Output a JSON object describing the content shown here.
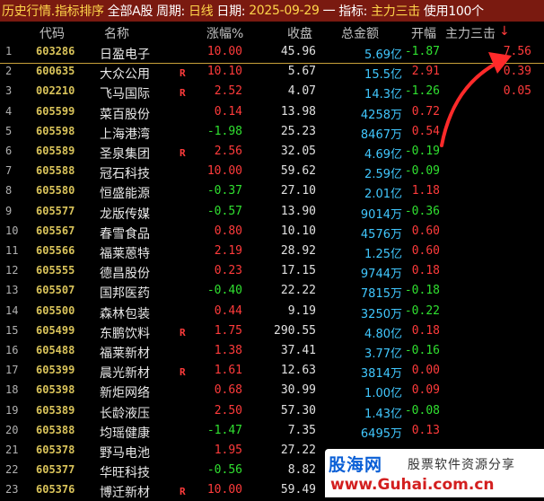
{
  "titlebar": {
    "history": "历史行情.指标排序",
    "market": "全部A股",
    "period_label": "周期:",
    "period_value": "日线",
    "date_label": "日期:",
    "date_value": "2025-09-29",
    "dash": "一",
    "indicator_label": "指标:",
    "indicator_value": "主力三击",
    "use_text": "使用100个"
  },
  "header": {
    "code": "代码",
    "name": "名称",
    "change": "涨幅%",
    "close": "收盘",
    "amount": "总金额",
    "open": "开幅",
    "zl": "主力三击",
    "sort_arrow": "↓"
  },
  "rows": [
    {
      "idx": "1",
      "code": "603286",
      "name": "日盈电子",
      "flag": "",
      "change": "10.00",
      "close": "45.96",
      "amount": "5.69亿",
      "open": "-1.87",
      "zl": "7.56"
    },
    {
      "idx": "2",
      "code": "600635",
      "name": "大众公用",
      "flag": "R",
      "change": "10.10",
      "close": "5.67",
      "amount": "15.5亿",
      "open": "2.91",
      "zl": "0.39"
    },
    {
      "idx": "3",
      "code": "002210",
      "name": "飞马国际",
      "flag": "R",
      "change": "2.52",
      "close": "4.07",
      "amount": "14.3亿",
      "open": "-1.26",
      "zl": "0.05"
    },
    {
      "idx": "4",
      "code": "605599",
      "name": "菜百股份",
      "flag": "",
      "change": "0.14",
      "close": "13.98",
      "amount": "4258万",
      "open": "0.72",
      "zl": ""
    },
    {
      "idx": "5",
      "code": "605598",
      "name": "上海港湾",
      "flag": "",
      "change": "-1.98",
      "close": "25.23",
      "amount": "8467万",
      "open": "0.54",
      "zl": ""
    },
    {
      "idx": "6",
      "code": "605589",
      "name": "圣泉集团",
      "flag": "R",
      "change": "2.56",
      "close": "32.05",
      "amount": "4.69亿",
      "open": "-0.19",
      "zl": ""
    },
    {
      "idx": "7",
      "code": "605588",
      "name": "冠石科技",
      "flag": "",
      "change": "10.00",
      "close": "59.62",
      "amount": "2.59亿",
      "open": "-0.09",
      "zl": ""
    },
    {
      "idx": "8",
      "code": "605580",
      "name": "恒盛能源",
      "flag": "",
      "change": "-0.37",
      "close": "27.10",
      "amount": "2.01亿",
      "open": "1.18",
      "zl": ""
    },
    {
      "idx": "9",
      "code": "605577",
      "name": "龙版传媒",
      "flag": "",
      "change": "-0.57",
      "close": "13.90",
      "amount": "9014万",
      "open": "-0.36",
      "zl": ""
    },
    {
      "idx": "10",
      "code": "605567",
      "name": "春雪食品",
      "flag": "",
      "change": "0.80",
      "close": "10.10",
      "amount": "4576万",
      "open": "0.60",
      "zl": ""
    },
    {
      "idx": "11",
      "code": "605566",
      "name": "福莱蒽特",
      "flag": "",
      "change": "2.19",
      "close": "28.92",
      "amount": "1.25亿",
      "open": "0.60",
      "zl": ""
    },
    {
      "idx": "12",
      "code": "605555",
      "name": "德昌股份",
      "flag": "",
      "change": "0.23",
      "close": "17.15",
      "amount": "9744万",
      "open": "0.18",
      "zl": ""
    },
    {
      "idx": "13",
      "code": "605507",
      "name": "国邦医药",
      "flag": "",
      "change": "-0.40",
      "close": "22.22",
      "amount": "7815万",
      "open": "-0.18",
      "zl": ""
    },
    {
      "idx": "14",
      "code": "605500",
      "name": "森林包装",
      "flag": "",
      "change": "0.44",
      "close": "9.19",
      "amount": "3250万",
      "open": "-0.22",
      "zl": ""
    },
    {
      "idx": "15",
      "code": "605499",
      "name": "东鹏饮料",
      "flag": "R",
      "change": "1.75",
      "close": "290.55",
      "amount": "4.80亿",
      "open": "0.18",
      "zl": ""
    },
    {
      "idx": "16",
      "code": "605488",
      "name": "福莱新材",
      "flag": "",
      "change": "1.38",
      "close": "37.41",
      "amount": "3.77亿",
      "open": "-0.16",
      "zl": ""
    },
    {
      "idx": "17",
      "code": "605399",
      "name": "晨光新材",
      "flag": "R",
      "change": "1.61",
      "close": "12.63",
      "amount": "3814万",
      "open": "0.00",
      "zl": ""
    },
    {
      "idx": "18",
      "code": "605398",
      "name": "新炬网络",
      "flag": "",
      "change": "0.68",
      "close": "30.99",
      "amount": "1.00亿",
      "open": "0.09",
      "zl": ""
    },
    {
      "idx": "19",
      "code": "605389",
      "name": "长龄液压",
      "flag": "",
      "change": "2.50",
      "close": "57.30",
      "amount": "1.43亿",
      "open": "-0.08",
      "zl": ""
    },
    {
      "idx": "20",
      "code": "605388",
      "name": "均瑶健康",
      "flag": "",
      "change": "-1.47",
      "close": "7.35",
      "amount": "6495万",
      "open": "0.13",
      "zl": ""
    },
    {
      "idx": "21",
      "code": "605378",
      "name": "野马电池",
      "flag": "",
      "change": "1.95",
      "close": "27.22",
      "amount": "",
      "open": "",
      "zl": ""
    },
    {
      "idx": "22",
      "code": "605377",
      "name": "华旺科技",
      "flag": "",
      "change": "-0.56",
      "close": "8.82",
      "amount": "",
      "open": "",
      "zl": ""
    },
    {
      "idx": "23",
      "code": "605376",
      "name": "博迁新材",
      "flag": "R",
      "change": "10.00",
      "close": "59.49",
      "amount": "",
      "open": "",
      "zl": ""
    }
  ],
  "watermark": {
    "logo": "股海网",
    "slogan": "股票软件资源分享",
    "url": "www.Guhai.com.cn"
  },
  "colors": {
    "up": "#ff3b3b",
    "down": "#30e030",
    "amount": "#41c8ff",
    "code": "#d9c35a",
    "titlebar_bg": "#7a1a10"
  }
}
